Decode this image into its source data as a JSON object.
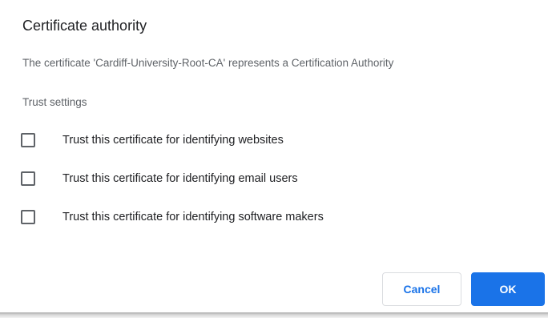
{
  "dialog": {
    "title": "Certificate authority",
    "description": "The certificate 'Cardiff-University-Root-CA' represents a Certification Authority",
    "section_label": "Trust settings",
    "options": [
      {
        "label": "Trust this certificate for identifying websites",
        "checked": false
      },
      {
        "label": "Trust this certificate for identifying email users",
        "checked": false
      },
      {
        "label": "Trust this certificate for identifying software makers",
        "checked": false
      }
    ],
    "buttons": {
      "cancel_label": "Cancel",
      "ok_label": "OK"
    }
  },
  "colors": {
    "primary": "#1a73e8",
    "text": "#202124",
    "secondary_text": "#5f6368",
    "border": "#dadce0"
  }
}
